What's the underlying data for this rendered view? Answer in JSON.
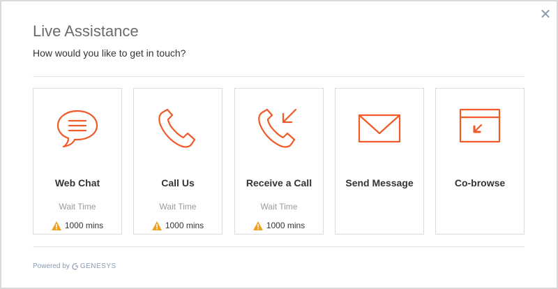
{
  "dialog": {
    "title": "Live Assistance",
    "subtitle": "How would you like to get in touch?",
    "close_label": "✕"
  },
  "colors": {
    "accent": "#f05a28",
    "warning": "#f0a020"
  },
  "options": [
    {
      "label": "Web Chat",
      "wait_label": "Wait Time",
      "wait_value": "1000 mins",
      "icon": "chat-icon"
    },
    {
      "label": "Call Us",
      "wait_label": "Wait Time",
      "wait_value": "1000 mins",
      "icon": "phone-icon"
    },
    {
      "label": "Receive a Call",
      "wait_label": "Wait Time",
      "wait_value": "1000 mins",
      "icon": "incoming-call-icon"
    },
    {
      "label": "Send Message",
      "icon": "envelope-icon"
    },
    {
      "label": "Co-browse",
      "icon": "browser-icon"
    }
  ],
  "footer": {
    "powered_by": "Powered by",
    "brand": "GENESYS"
  }
}
